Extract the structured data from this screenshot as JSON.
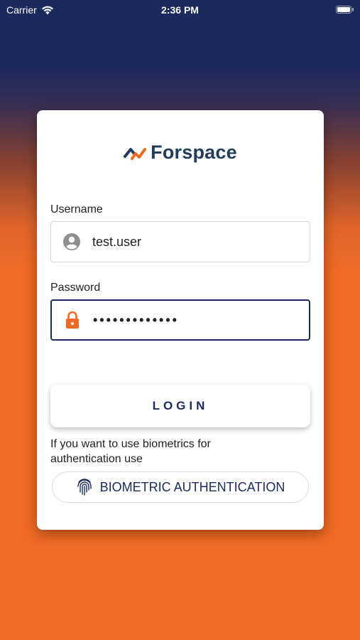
{
  "status_bar": {
    "carrier": "Carrier",
    "time": "2:36 PM",
    "battery_level": 1.0
  },
  "brand": {
    "name": "Forspace",
    "colors": {
      "navy": "#1b2a5e",
      "orange": "#f06a24",
      "logo_text": "#1f3c5a"
    }
  },
  "form": {
    "username": {
      "label": "Username",
      "value": "test.user",
      "icon": "account-circle-icon"
    },
    "password": {
      "label": "Password",
      "value": "•••••••••••••",
      "icon": "lock-icon"
    },
    "login_label": "LOGIN"
  },
  "biometrics": {
    "note": "If you want to use biometrics for authentication use",
    "button_label": "BIOMETRIC AUTHENTICATION",
    "icon": "fingerprint-icon"
  }
}
